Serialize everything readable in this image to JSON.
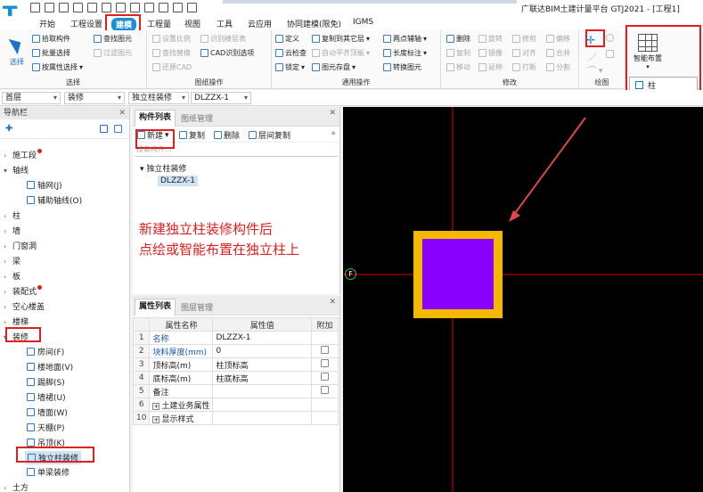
{
  "app_title": "广联达BIM土建计量平台 GTJ2021 - [工程1]",
  "tabs": [
    "开始",
    "工程设置",
    "建模",
    "工程量",
    "视图",
    "工具",
    "云应用",
    "协同建模(限免)",
    "IGMS"
  ],
  "active_tab": "建模",
  "ribbon": {
    "select_group": {
      "select": "选择",
      "pick": "拾取构件",
      "batch": "批量选择",
      "by_attr": "按属性选择",
      "find": "查找图元",
      "filter": "过滤图元",
      "label": "选择"
    },
    "drawing_group": {
      "scale": "设置比例",
      "recognize_floor": "识别楼层表",
      "find_replace": "查找替换",
      "cad_options": "CAD识别选项",
      "restore_cad": "还原CAD",
      "label": "图纸操作"
    },
    "common_group": {
      "define": "定义",
      "copy_floor": "复制到其它层",
      "two_point_axis": "两点辅轴",
      "cloud_check": "云检查",
      "auto_flatten": "自动平齐顶板",
      "length_label": "长度标注",
      "lock": "锁定",
      "element_save": "图元存盘",
      "convert": "转换图元",
      "label": "通用操作"
    },
    "modify_group": {
      "delete": "删除",
      "rotate": "旋转",
      "trim": "修剪",
      "offset": "偏移",
      "copy": "复制",
      "mirror": "镜像",
      "align": "对齐",
      "merge": "合并",
      "move": "移动",
      "extend": "延伸",
      "break": "打断",
      "split": "分割",
      "label": "修改"
    },
    "draw_group": {
      "label": "绘图"
    },
    "smart_layout": "智能布置",
    "smart_menu_item": "柱"
  },
  "selectors": [
    "首层",
    "装修",
    "独立柱装修",
    "DLZZX-1"
  ],
  "nav": {
    "title": "导航栏",
    "items": [
      "施工段",
      "轴线",
      "柱",
      "墙",
      "门窗洞",
      "梁",
      "板",
      "装配式",
      "空心楼盖",
      "楼梯",
      "装修",
      "土方"
    ],
    "axis_children": [
      "轴网(J)",
      "辅助轴线(O)"
    ],
    "decor_children": [
      "房间(F)",
      "楼地面(V)",
      "踢脚(S)",
      "墙裙(U)",
      "墙面(W)",
      "天棚(P)",
      "吊顶(K)",
      "独立柱装修",
      "单梁装修"
    ]
  },
  "component_panel": {
    "tabs": [
      "构件列表",
      "图纸管理"
    ],
    "new": "新建",
    "copy": "复制",
    "delete": "删除",
    "floor_copy": "层间复制",
    "search_placeholder": "搜索构件...",
    "tree_parent": "独立柱装修",
    "tree_child": "DLZZX-1"
  },
  "annotation": [
    "新建独立柱装修构件后",
    "点绘或智能布置在独立柱上"
  ],
  "properties": {
    "tabs": [
      "属性列表",
      "图层管理"
    ],
    "headers": [
      "属性名称",
      "属性值",
      "附加"
    ],
    "rows": [
      {
        "n": "1",
        "name": "名称",
        "value": "DLZZX-1",
        "check": false
      },
      {
        "n": "2",
        "name": "块料厚度(mm)",
        "value": "0",
        "check": true
      },
      {
        "n": "3",
        "name": "顶标高(m)",
        "value": "柱顶标高",
        "check": true
      },
      {
        "n": "4",
        "name": "底标高(m)",
        "value": "柱底标高",
        "check": true
      },
      {
        "n": "5",
        "name": "备注",
        "value": "",
        "check": true
      },
      {
        "n": "6",
        "name": "土建业务属性",
        "value": "",
        "check": false
      },
      {
        "n": "10",
        "name": "显示样式",
        "value": "",
        "check": false
      }
    ]
  },
  "canvas": {
    "axis_label": "F",
    "colors": {
      "outer": "#F5B800",
      "inner": "#8A00FF",
      "axis": "#E00000",
      "arrow": "#E04848"
    }
  }
}
